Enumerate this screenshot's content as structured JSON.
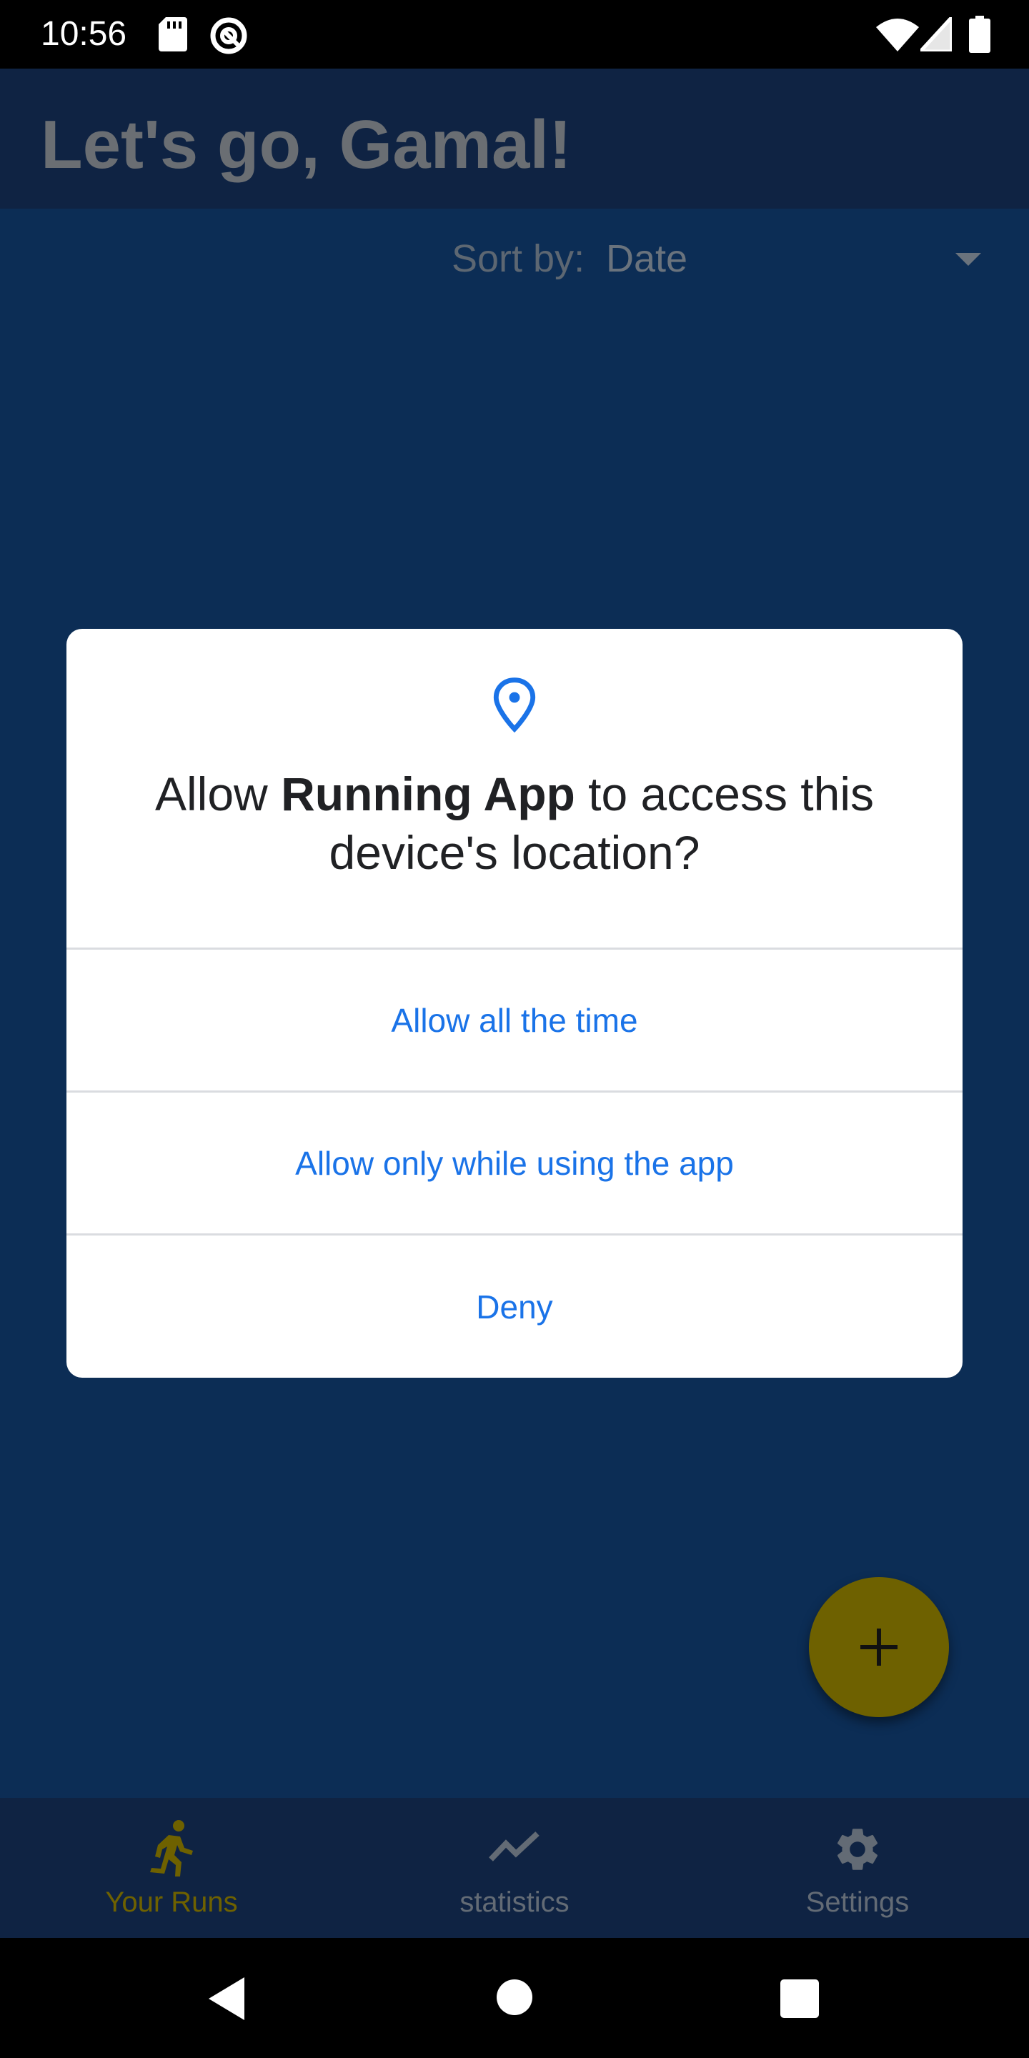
{
  "status_bar": {
    "time": "10:56",
    "icons": [
      "sd-card-icon",
      "at-sign-icon",
      "wifi-icon",
      "signal-icon",
      "battery-icon"
    ]
  },
  "app_bar": {
    "title": "Let's go, Gamal!"
  },
  "sort": {
    "label": "Sort by:",
    "value": "Date"
  },
  "fab": {
    "icon": "plus-icon",
    "color": "#6e6100"
  },
  "bottom_nav": {
    "items": [
      {
        "label": "Your Runs",
        "icon": "running-person-icon",
        "active": true
      },
      {
        "label": "statistics",
        "icon": "trending-up-icon",
        "active": false
      },
      {
        "label": "Settings",
        "icon": "gear-icon",
        "active": false
      }
    ]
  },
  "dialog": {
    "icon": "location-pin-icon",
    "title_before": "Allow ",
    "title_app": "Running App",
    "title_after": " to access this device's location?",
    "buttons": [
      {
        "label": "Allow all the time"
      },
      {
        "label": "Allow only while using the app"
      },
      {
        "label": "Deny"
      }
    ],
    "accent_color": "#1a73e8"
  },
  "colors": {
    "background": "#0c2d55",
    "app_bar": "#0f2343",
    "active_nav": "#6e6100"
  }
}
